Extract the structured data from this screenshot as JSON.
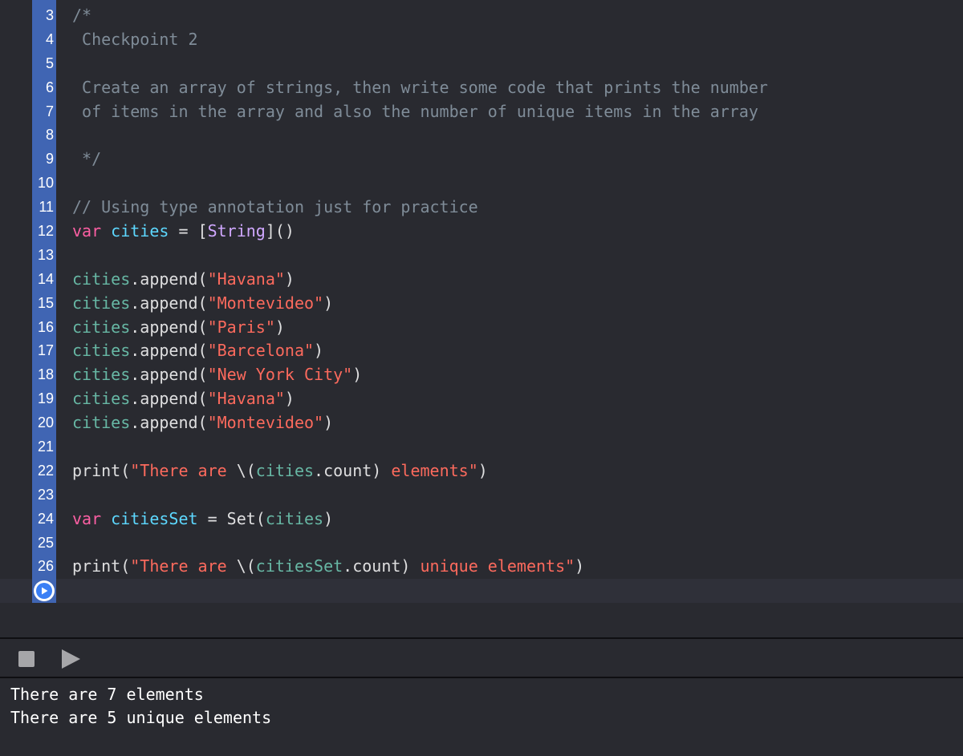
{
  "colors": {
    "background": "#292a30",
    "gutter_accent": "#4065b3",
    "comment": "#7f8c98",
    "keyword": "#fc5fa3",
    "string": "#fc6a5d",
    "identifier": "#67b7a4",
    "var_declaration": "#5dd8ff",
    "type": "#d0a8ff",
    "plain": "#dfdfe0"
  },
  "editor": {
    "lines": [
      {
        "number": "3",
        "tokens": [
          {
            "t": "/*",
            "k": "comment"
          }
        ]
      },
      {
        "number": "4",
        "tokens": [
          {
            "t": " Checkpoint 2",
            "k": "comment"
          }
        ]
      },
      {
        "number": "5",
        "tokens": []
      },
      {
        "number": "6",
        "tokens": [
          {
            "t": " Create an array of strings, then write some code that prints the number",
            "k": "comment"
          }
        ]
      },
      {
        "number": "7",
        "tokens": [
          {
            "t": " of items in the array and also the number of unique items in the array",
            "k": "comment"
          }
        ]
      },
      {
        "number": "8",
        "tokens": []
      },
      {
        "number": "9",
        "tokens": [
          {
            "t": " */",
            "k": "comment"
          }
        ]
      },
      {
        "number": "10",
        "tokens": []
      },
      {
        "number": "11",
        "tokens": [
          {
            "t": "// Using type annotation just for practice",
            "k": "comment"
          }
        ]
      },
      {
        "number": "12",
        "tokens": [
          {
            "t": "var",
            "k": "keyword"
          },
          {
            "t": " ",
            "k": "plain"
          },
          {
            "t": "cities",
            "k": "var_declaration"
          },
          {
            "t": " = [",
            "k": "plain"
          },
          {
            "t": "String",
            "k": "type"
          },
          {
            "t": "]()",
            "k": "plain"
          }
        ]
      },
      {
        "number": "13",
        "tokens": []
      },
      {
        "number": "14",
        "tokens": [
          {
            "t": "cities",
            "k": "identifier"
          },
          {
            "t": ".append(",
            "k": "plain"
          },
          {
            "t": "\"Havana\"",
            "k": "string"
          },
          {
            "t": ")",
            "k": "plain"
          }
        ]
      },
      {
        "number": "15",
        "tokens": [
          {
            "t": "cities",
            "k": "identifier"
          },
          {
            "t": ".append(",
            "k": "plain"
          },
          {
            "t": "\"Montevideo\"",
            "k": "string"
          },
          {
            "t": ")",
            "k": "plain"
          }
        ]
      },
      {
        "number": "16",
        "tokens": [
          {
            "t": "cities",
            "k": "identifier"
          },
          {
            "t": ".append(",
            "k": "plain"
          },
          {
            "t": "\"Paris\"",
            "k": "string"
          },
          {
            "t": ")",
            "k": "plain"
          }
        ]
      },
      {
        "number": "17",
        "tokens": [
          {
            "t": "cities",
            "k": "identifier"
          },
          {
            "t": ".append(",
            "k": "plain"
          },
          {
            "t": "\"Barcelona\"",
            "k": "string"
          },
          {
            "t": ")",
            "k": "plain"
          }
        ]
      },
      {
        "number": "18",
        "tokens": [
          {
            "t": "cities",
            "k": "identifier"
          },
          {
            "t": ".append(",
            "k": "plain"
          },
          {
            "t": "\"New York City\"",
            "k": "string"
          },
          {
            "t": ")",
            "k": "plain"
          }
        ]
      },
      {
        "number": "19",
        "tokens": [
          {
            "t": "cities",
            "k": "identifier"
          },
          {
            "t": ".append(",
            "k": "plain"
          },
          {
            "t": "\"Havana\"",
            "k": "string"
          },
          {
            "t": ")",
            "k": "plain"
          }
        ]
      },
      {
        "number": "20",
        "tokens": [
          {
            "t": "cities",
            "k": "identifier"
          },
          {
            "t": ".append(",
            "k": "plain"
          },
          {
            "t": "\"Montevideo\"",
            "k": "string"
          },
          {
            "t": ")",
            "k": "plain"
          }
        ]
      },
      {
        "number": "21",
        "tokens": []
      },
      {
        "number": "22",
        "tokens": [
          {
            "t": "print(",
            "k": "plain"
          },
          {
            "t": "\"There are ",
            "k": "string"
          },
          {
            "t": "\\(",
            "k": "plain"
          },
          {
            "t": "cities",
            "k": "identifier"
          },
          {
            "t": ".count)",
            "k": "plain"
          },
          {
            "t": " elements\"",
            "k": "string"
          },
          {
            "t": ")",
            "k": "plain"
          }
        ]
      },
      {
        "number": "23",
        "tokens": []
      },
      {
        "number": "24",
        "tokens": [
          {
            "t": "var",
            "k": "keyword"
          },
          {
            "t": " ",
            "k": "plain"
          },
          {
            "t": "citiesSet",
            "k": "var_declaration"
          },
          {
            "t": " = Set(",
            "k": "plain"
          },
          {
            "t": "cities",
            "k": "identifier"
          },
          {
            "t": ")",
            "k": "plain"
          }
        ]
      },
      {
        "number": "25",
        "tokens": []
      },
      {
        "number": "26",
        "tokens": [
          {
            "t": "print(",
            "k": "plain"
          },
          {
            "t": "\"There are ",
            "k": "string"
          },
          {
            "t": "\\(",
            "k": "plain"
          },
          {
            "t": "citiesSet",
            "k": "identifier"
          },
          {
            "t": ".count)",
            "k": "plain"
          },
          {
            "t": " unique elements\"",
            "k": "string"
          },
          {
            "t": ")",
            "k": "plain"
          }
        ]
      }
    ]
  },
  "run_controls": {
    "run_line_icon": "play-circle-icon",
    "stop_icon": "stop-icon",
    "play_icon": "play-icon"
  },
  "console": {
    "output_lines": [
      "There are 7 elements",
      "There are 5 unique elements"
    ]
  }
}
